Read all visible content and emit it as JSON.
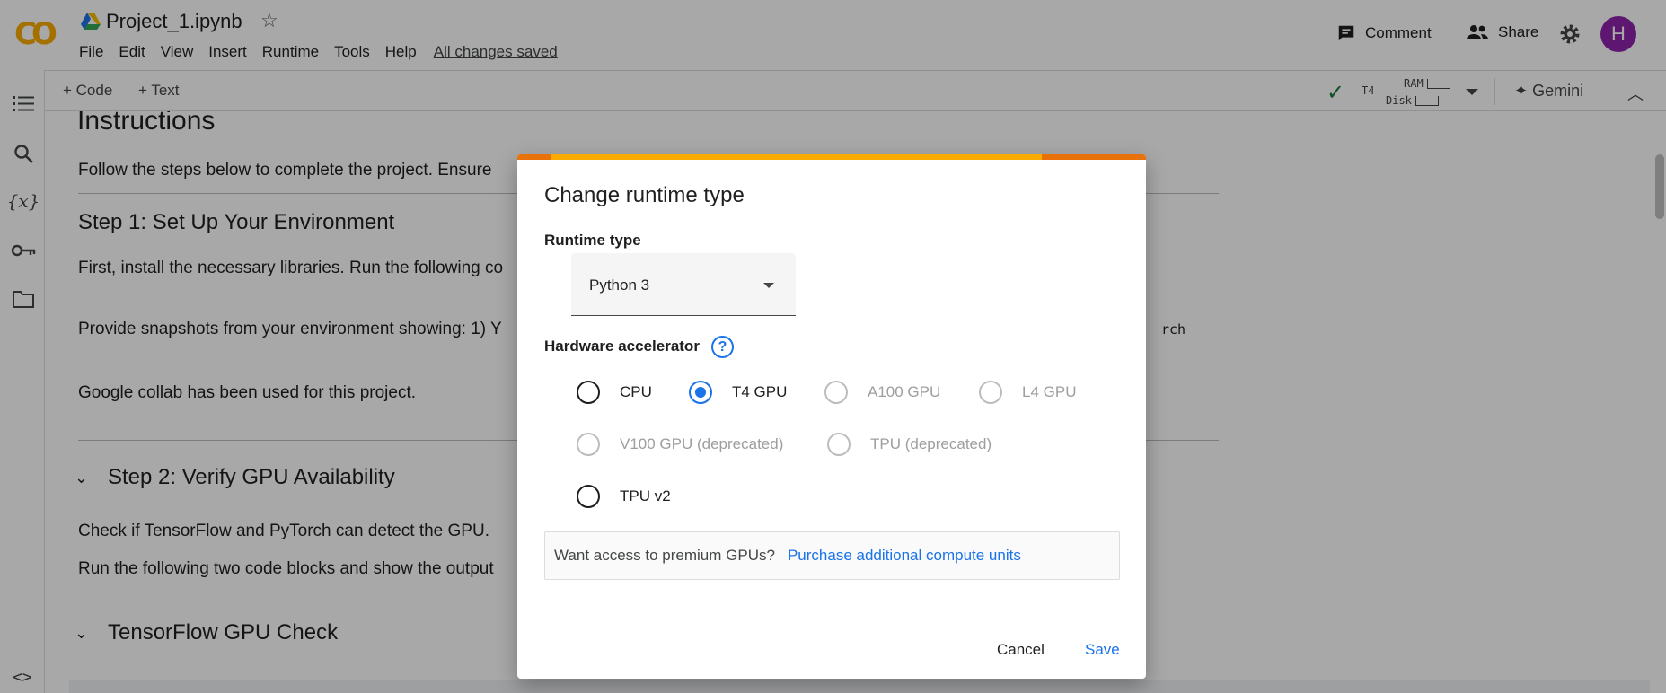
{
  "header": {
    "title": "Project_1.ipynb",
    "logo_text": "CO",
    "menu": [
      "File",
      "Edit",
      "View",
      "Insert",
      "Runtime",
      "Tools",
      "Help"
    ],
    "saved_status": "All changes saved",
    "comment_label": "Comment",
    "share_label": "Share",
    "avatar_letter": "H"
  },
  "toolbar": {
    "add_code": "+ Code",
    "add_text": "+ Text",
    "runtime_accelerator": "T4",
    "ram_label": "RAM",
    "disk_label": "Disk",
    "gemini_label": "✦ Gemini"
  },
  "notebook": {
    "heading": "Instructions",
    "para1": "Follow the steps below to complete the project. Ensure",
    "step1_heading": "Step 1: Set Up Your Environment",
    "para2": "First, install the necessary libraries. Run the following co",
    "para3": "Provide snapshots from your environment showing: 1) Y",
    "para3_code_fragment": "rch",
    "para4": "Google collab has been used for this project.",
    "step2_heading": "Step 2: Verify GPU Availability",
    "para5": "Check if TensorFlow and PyTorch can detect the GPU.",
    "para6": "Run the following two code blocks and show the output",
    "tf_heading": "TensorFlow GPU Check"
  },
  "dialog": {
    "title": "Change runtime type",
    "runtime_type_label": "Runtime type",
    "runtime_type_value": "Python 3",
    "hardware_label": "Hardware accelerator",
    "help_glyph": "?",
    "options": [
      {
        "label": "CPU",
        "checked": false,
        "disabled": false
      },
      {
        "label": "T4 GPU",
        "checked": true,
        "disabled": false
      },
      {
        "label": "A100 GPU",
        "checked": false,
        "disabled": true
      },
      {
        "label": "L4 GPU",
        "checked": false,
        "disabled": true
      },
      {
        "label": "V100 GPU (deprecated)",
        "checked": false,
        "disabled": true
      },
      {
        "label": "TPU (deprecated)",
        "checked": false,
        "disabled": true
      },
      {
        "label": "TPU v2",
        "checked": false,
        "disabled": false
      }
    ],
    "premium_text": "Want access to premium GPUs?",
    "premium_link": "Purchase additional compute units",
    "cancel_label": "Cancel",
    "save_label": "Save"
  },
  "colors": {
    "accent_blue": "#1a73e8",
    "colab_orange": "#f9ab00",
    "colab_dark_orange": "#e8710a",
    "avatar_purple": "#8e24aa",
    "status_green": "#188038"
  }
}
